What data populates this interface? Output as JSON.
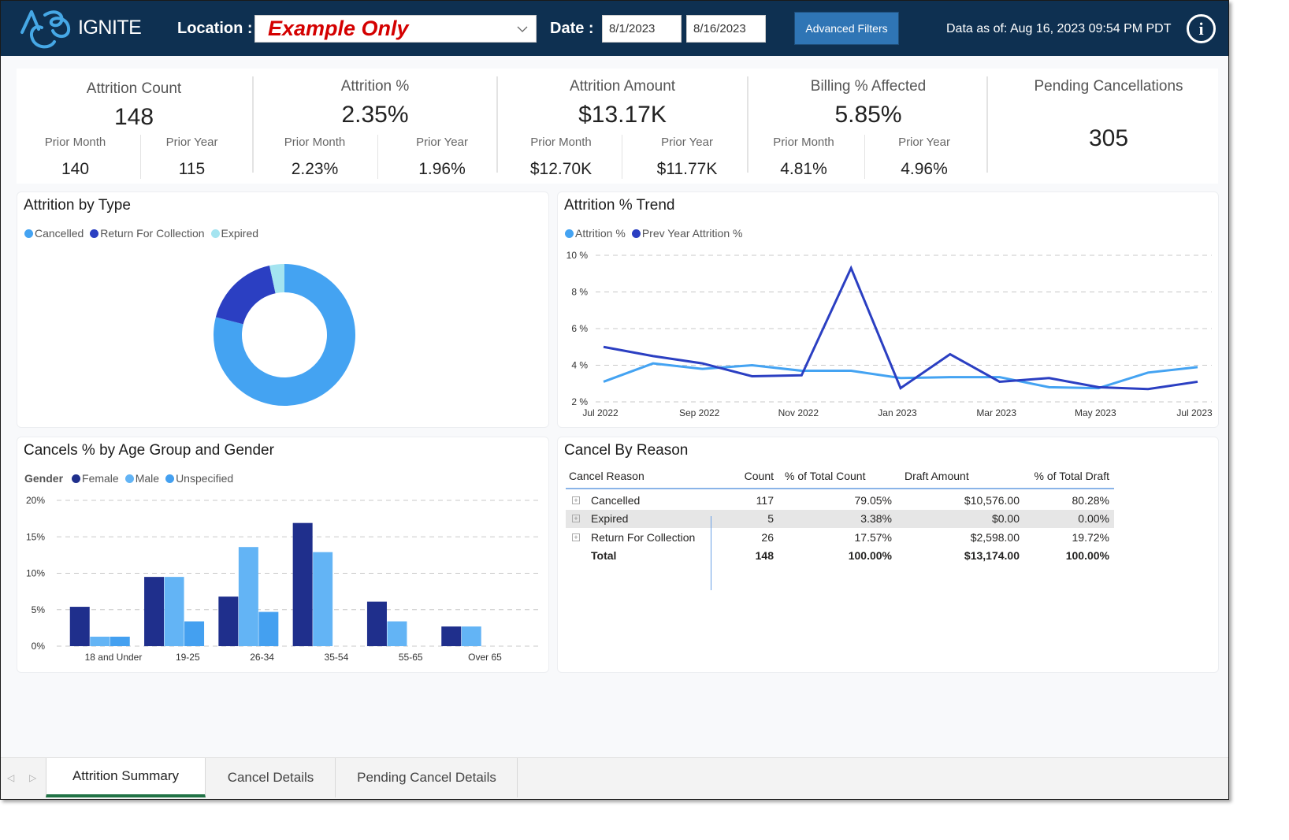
{
  "header": {
    "app_name": "IGNITE",
    "location_label": "Location :",
    "location_value": "Example Only",
    "date_label": "Date :",
    "date_start": "8/1/2023",
    "date_end": "8/16/2023",
    "advanced_filters_label": "Advanced Filters",
    "data_as_of": "Data as of: Aug 16, 2023  09:54 PM PDT",
    "info_icon_glyph": "i"
  },
  "kpis": [
    {
      "title": "Attrition Count",
      "value": "148",
      "prior_month_label": "Prior Month",
      "prior_month": "140",
      "prior_year_label": "Prior Year",
      "prior_year": "115"
    },
    {
      "title": "Attrition %",
      "value": "2.35%",
      "prior_month_label": "Prior Month",
      "prior_month": "2.23%",
      "prior_year_label": "Prior Year",
      "prior_year": "1.96%"
    },
    {
      "title": "Attrition Amount",
      "value": "$13.17K",
      "prior_month_label": "Prior Month",
      "prior_month": "$12.70K",
      "prior_year_label": "Prior Year",
      "prior_year": "$11.77K"
    },
    {
      "title": "Billing % Affected",
      "value": "5.85%",
      "prior_month_label": "Prior Month",
      "prior_month": "4.81%",
      "prior_year_label": "Prior Year",
      "prior_year": "4.96%"
    },
    {
      "title": "Pending Cancellations",
      "value": "305"
    }
  ],
  "colors": {
    "header_bg": "#0e3051",
    "cancelled": "#44a3f2",
    "return_for_collection": "#2b3fc2",
    "expired": "#a4e4f0",
    "attrition_pct": "#44a3f2",
    "prev_year_attrition_pct": "#2b3fc2",
    "female": "#1f2f8c",
    "male": "#63b4f5",
    "unspecified": "#44a0f0",
    "location_value": "#d40000",
    "active_tab_underline": "#217346"
  },
  "chart_data": [
    {
      "id": "attrition_by_type",
      "type": "pie",
      "title": "Attrition by Type",
      "legend": [
        "Cancelled",
        "Return For Collection",
        "Expired"
      ],
      "legend_position": "top-left",
      "donut": true,
      "categories": [
        "Cancelled",
        "Return For Collection",
        "Expired"
      ],
      "values": [
        117,
        26,
        5
      ]
    },
    {
      "id": "attrition_trend",
      "type": "line",
      "title": "Attrition % Trend",
      "legend": [
        "Attrition %",
        "Prev Year Attrition %"
      ],
      "legend_position": "top-left",
      "x": [
        "Jul 2022",
        "Aug 2022",
        "Sep 2022",
        "Oct 2022",
        "Nov 2022",
        "Dec 2022",
        "Jan 2023",
        "Feb 2023",
        "Mar 2023",
        "Apr 2023",
        "May 2023",
        "Jun 2023",
        "Jul 2023"
      ],
      "x_tick_labels": [
        "Jul 2022",
        "Sep 2022",
        "Nov 2022",
        "Jan 2023",
        "Mar 2023",
        "May 2023",
        "Jul 2023"
      ],
      "series": [
        {
          "name": "Attrition %",
          "values": [
            3.1,
            4.1,
            3.8,
            4.0,
            3.7,
            3.7,
            3.3,
            3.35,
            3.35,
            2.8,
            2.75,
            3.6,
            3.9
          ]
        },
        {
          "name": "Prev Year Attrition %",
          "values": [
            5.0,
            4.5,
            4.1,
            3.4,
            3.45,
            9.3,
            2.75,
            4.6,
            3.1,
            3.3,
            2.8,
            2.7,
            3.1
          ]
        }
      ],
      "y_ticks": [
        "2 %",
        "4 %",
        "6 %",
        "8 %",
        "10 %"
      ],
      "ylim": [
        2,
        10
      ],
      "grid": true
    },
    {
      "id": "cancels_by_age_gender",
      "type": "bar",
      "title": "Cancels % by Age Group and Gender",
      "legend_title": "Gender",
      "legend": [
        "Female",
        "Male",
        "Unspecified"
      ],
      "legend_position": "top-left",
      "categories": [
        "18 and Under",
        "19-25",
        "26-34",
        "35-54",
        "55-65",
        "Over 65"
      ],
      "series": [
        {
          "name": "Female",
          "values": [
            5.4,
            9.5,
            6.8,
            16.9,
            6.1,
            2.7
          ]
        },
        {
          "name": "Male",
          "values": [
            1.3,
            9.5,
            13.6,
            12.9,
            3.4,
            2.7
          ]
        },
        {
          "name": "Unspecified",
          "values": [
            1.3,
            3.4,
            4.7,
            null,
            null,
            null
          ]
        }
      ],
      "y_ticks": [
        "0%",
        "5%",
        "10%",
        "15%",
        "20%"
      ],
      "ylim": [
        0,
        20
      ],
      "grid": true
    }
  ],
  "cancel_by_reason": {
    "title": "Cancel By Reason",
    "columns": [
      "Cancel Reason",
      "Count",
      "% of Total Count",
      "Draft Amount",
      "% of Total Draft"
    ],
    "rows": [
      {
        "reason": "Cancelled",
        "count": "117",
        "pct_count": "79.05%",
        "draft": "$10,576.00",
        "pct_draft": "80.28%"
      },
      {
        "reason": "Expired",
        "count": "5",
        "pct_count": "3.38%",
        "draft": "$0.00",
        "pct_draft": "0.00%"
      },
      {
        "reason": "Return For Collection",
        "count": "26",
        "pct_count": "17.57%",
        "draft": "$2,598.00",
        "pct_draft": "19.72%"
      }
    ],
    "total": {
      "reason": "Total",
      "count": "148",
      "pct_count": "100.00%",
      "draft": "$13,174.00",
      "pct_draft": "100.00%"
    },
    "expand_glyph": "+"
  },
  "tabs": [
    {
      "label": "Attrition Summary",
      "active": true
    },
    {
      "label": "Cancel Details",
      "active": false
    },
    {
      "label": "Pending Cancel Details",
      "active": false
    }
  ],
  "tab_nav": {
    "prev_glyph": "◁",
    "next_glyph": "▷"
  }
}
